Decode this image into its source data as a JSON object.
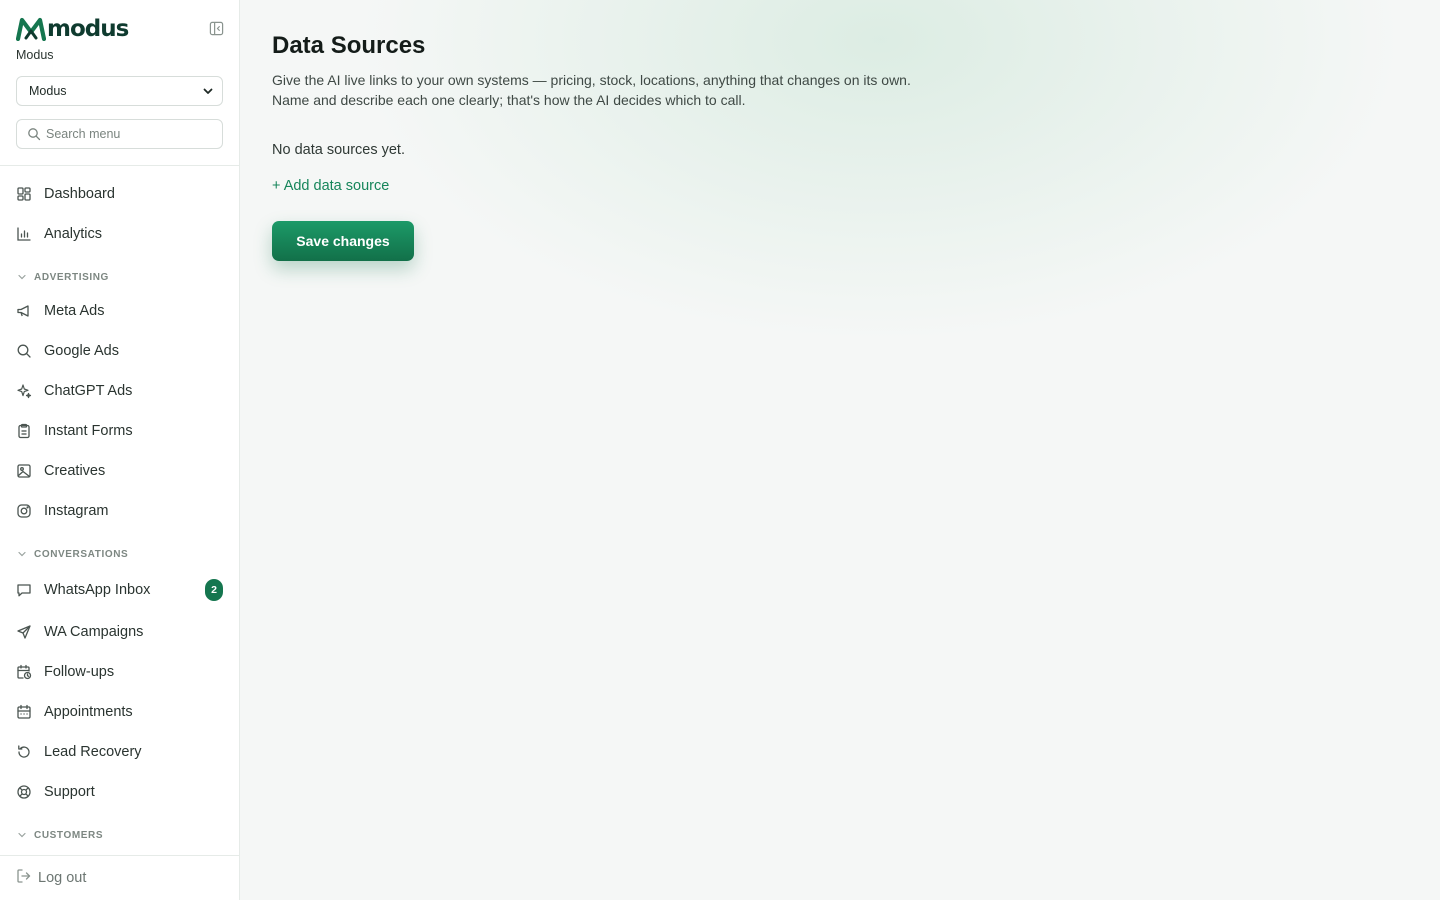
{
  "brand": {
    "logo_text": "modus",
    "workspace_name": "Modus"
  },
  "workspace_select": {
    "selected": "Modus"
  },
  "search": {
    "placeholder": "Search menu"
  },
  "nav": {
    "dashboard": "Dashboard",
    "analytics": "Analytics",
    "section_advertising": "ADVERTISING",
    "meta_ads": "Meta Ads",
    "google_ads": "Google Ads",
    "chatgpt_ads": "ChatGPT Ads",
    "instant_forms": "Instant Forms",
    "creatives": "Creatives",
    "instagram": "Instagram",
    "section_conversations": "CONVERSATIONS",
    "whatsapp_inbox": "WhatsApp Inbox",
    "whatsapp_inbox_badge": "2",
    "wa_campaigns": "WA Campaigns",
    "follow_ups": "Follow-ups",
    "appointments": "Appointments",
    "lead_recovery": "Lead Recovery",
    "support": "Support",
    "section_customers": "CUSTOMERS",
    "log_out": "Log out"
  },
  "main": {
    "title": "Data Sources",
    "description_line1": "Give the AI live links to your own systems — pricing, stock, locations, anything that changes on its own.",
    "description_line2": "Name and describe each one clearly; that's how the AI decides which to call.",
    "empty_state": "No data sources yet.",
    "add_link": "+ Add data source",
    "save_button": "Save changes"
  },
  "colors": {
    "brand_green": "#15764f",
    "accent_link": "#16855a",
    "logo_dark": "#0f3b2f"
  },
  "icons": [
    "logo-mark",
    "sidebar-collapse-icon",
    "chevron-down-icon",
    "search-icon",
    "dashboard-grid-icon",
    "bar-chart-icon",
    "megaphone-icon",
    "magnifier-icon",
    "sparkles-icon",
    "clipboard-icon",
    "image-icon",
    "instagram-icon",
    "chat-bubble-icon",
    "send-icon",
    "calendar-clock-icon",
    "calendar-icon",
    "refresh-icon",
    "lifebuoy-icon",
    "logout-icon"
  ]
}
